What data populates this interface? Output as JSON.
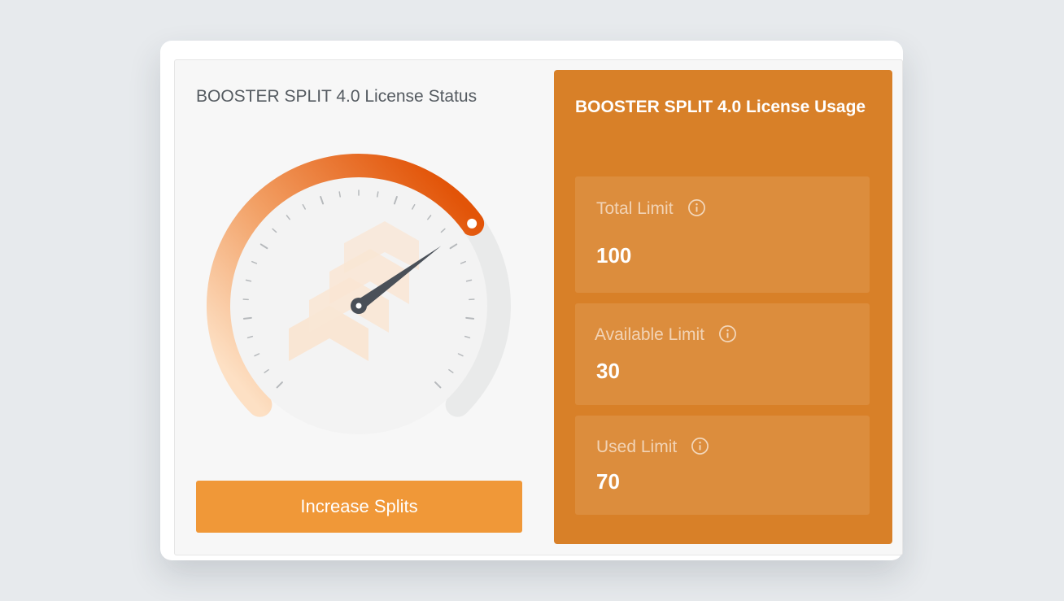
{
  "status_panel": {
    "title": "BOOSTER SPLIT 4.0 License Status",
    "gauge": {
      "used_fraction": 0.7,
      "colors": {
        "arc_start": "#fde0c4",
        "arc_mid": "#f2a065",
        "arc_end": "#e25408",
        "track": "#e9eaea",
        "needle": "#4a5058",
        "watermark": "#fbe4cf"
      },
      "icons": [
        "needle-icon",
        "booster-logo-watermark"
      ]
    },
    "increase_button_label": "Increase Splits"
  },
  "usage_panel": {
    "title": "BOOSTER SPLIT 4.0 License Usage",
    "metrics": [
      {
        "label": "Total Limit",
        "value": "100",
        "icon": "info-icon"
      },
      {
        "label": "Available Limit",
        "value": "30",
        "icon": "info-icon"
      },
      {
        "label": "Used Limit",
        "value": "70",
        "icon": "info-icon"
      }
    ]
  },
  "colors": {
    "accent_button": "#f09838",
    "usage_panel_bg": "#d88028",
    "page_bg": "#e7eaed"
  }
}
